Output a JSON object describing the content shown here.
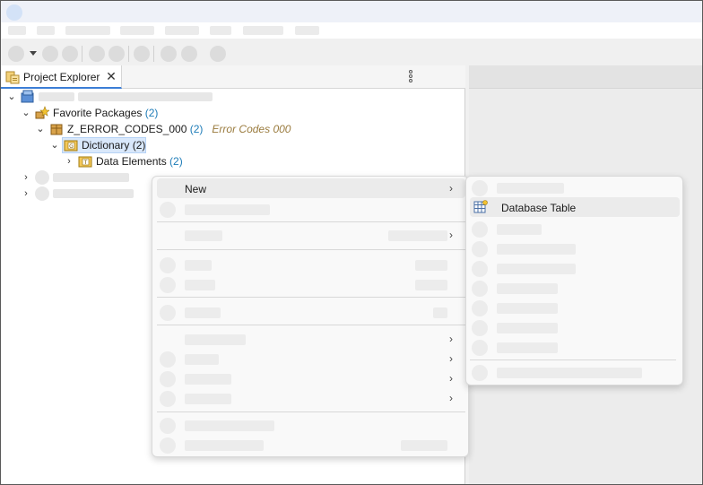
{
  "explorer": {
    "tab_label": "Project Explorer",
    "tree": {
      "favorite_packages": {
        "label": "Favorite Packages",
        "count": "(2)"
      },
      "package": {
        "label": "Z_ERROR_CODES_000",
        "count": "(2)",
        "description": "Error Codes 000"
      },
      "dictionary": {
        "label": "Dictionary",
        "count": "(2)"
      },
      "data_elements": {
        "label": "Data Elements",
        "count": "(2)"
      }
    }
  },
  "context_menu": {
    "new_label": "New"
  },
  "submenu": {
    "database_table_label": "Database Table"
  },
  "icons": {
    "tab": "project-explorer-icon",
    "project": "abap-project-icon",
    "favorites": "favorite-packages-icon",
    "package": "package-icon",
    "dictionary": "dictionary-folder-icon",
    "data_elements": "data-elements-folder-icon",
    "database_table": "database-table-icon"
  },
  "colors": {
    "accent": "#3c7ed6",
    "count": "#1e7cb8",
    "description": "#9a7b3e",
    "selection": "#d9e8fb"
  }
}
